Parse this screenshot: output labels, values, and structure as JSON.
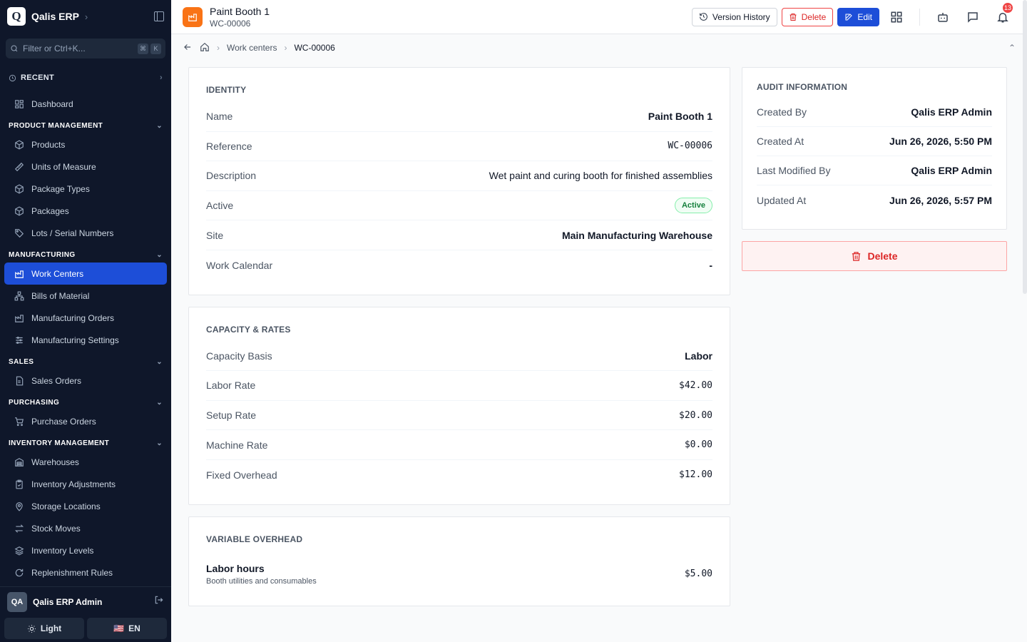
{
  "app": {
    "name": "Qalis ERP",
    "logo_letter": "Q"
  },
  "search": {
    "placeholder": "Filter or Ctrl+K...",
    "kbd1": "⌘",
    "kbd2": "K"
  },
  "recent_label": "RECENT",
  "nav": {
    "dashboard": "Dashboard",
    "product_management": {
      "label": "PRODUCT MANAGEMENT",
      "items": [
        "Products",
        "Units of Measure",
        "Package Types",
        "Packages",
        "Lots / Serial Numbers"
      ]
    },
    "manufacturing": {
      "label": "MANUFACTURING",
      "items": [
        "Work Centers",
        "Bills of Material",
        "Manufacturing Orders",
        "Manufacturing Settings"
      ]
    },
    "sales": {
      "label": "SALES",
      "items": [
        "Sales Orders"
      ]
    },
    "purchasing": {
      "label": "PURCHASING",
      "items": [
        "Purchase Orders"
      ]
    },
    "inventory": {
      "label": "INVENTORY MANAGEMENT",
      "items": [
        "Warehouses",
        "Inventory Adjustments",
        "Storage Locations",
        "Stock Moves",
        "Inventory Levels",
        "Replenishment Rules"
      ]
    }
  },
  "user": {
    "initials": "QA",
    "name": "Qalis ERP Admin"
  },
  "footer": {
    "theme": "Light",
    "lang": "EN",
    "flag": "🇺🇸"
  },
  "header": {
    "title": "Paint Booth 1",
    "subtitle": "WC-00006",
    "version_history": "Version History",
    "delete": "Delete",
    "edit": "Edit",
    "notifications": "13"
  },
  "breadcrumb": {
    "section": "Work centers",
    "current": "WC-00006"
  },
  "identity": {
    "title": "IDENTITY",
    "name_label": "Name",
    "name": "Paint Booth 1",
    "reference_label": "Reference",
    "reference": "WC-00006",
    "description_label": "Description",
    "description": "Wet paint and curing booth for finished assemblies",
    "active_label": "Active",
    "active": "Active",
    "site_label": "Site",
    "site": "Main Manufacturing Warehouse",
    "calendar_label": "Work Calendar",
    "calendar": "-"
  },
  "capacity": {
    "title": "CAPACITY & RATES",
    "basis_label": "Capacity Basis",
    "basis": "Labor",
    "labor_label": "Labor Rate",
    "labor": "$42.00",
    "setup_label": "Setup Rate",
    "setup": "$20.00",
    "machine_label": "Machine Rate",
    "machine": "$0.00",
    "overhead_label": "Fixed Overhead",
    "overhead": "$12.00"
  },
  "variable_overhead": {
    "title": "VARIABLE OVERHEAD",
    "name": "Labor hours",
    "desc": "Booth utilities and consumables",
    "value": "$5.00"
  },
  "audit": {
    "title": "AUDIT INFORMATION",
    "created_by_label": "Created By",
    "created_by": "Qalis ERP Admin",
    "created_at_label": "Created At",
    "created_at": "Jun 26, 2026, 5:50 PM",
    "modified_by_label": "Last Modified By",
    "modified_by": "Qalis ERP Admin",
    "updated_at_label": "Updated At",
    "updated_at": "Jun 26, 2026, 5:57 PM"
  },
  "delete_big": "Delete"
}
